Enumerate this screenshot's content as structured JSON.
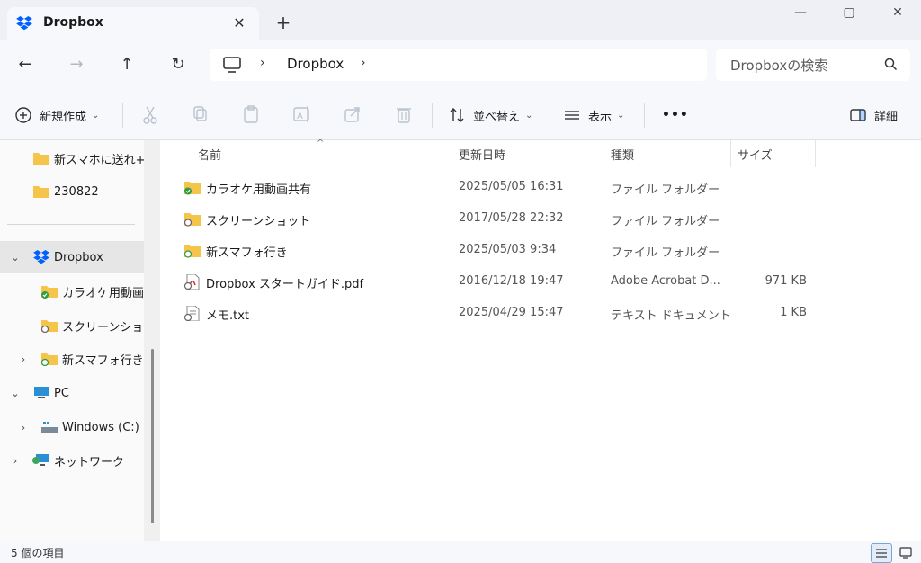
{
  "window": {
    "tab_title": "Dropbox",
    "tab_close_glyph": "✕",
    "new_tab_glyph": "+",
    "controls": {
      "minimize": "—",
      "maximize": "▢",
      "close": "✕"
    }
  },
  "nav": {
    "back": "←",
    "forward": "→",
    "up": "↑",
    "refresh": "↻",
    "breadcrumb": [
      "Dropbox"
    ],
    "separator": "›",
    "search_placeholder": "Dropboxの検索"
  },
  "commands": {
    "new": "新規作成",
    "sort": "並べ替え",
    "view": "表示",
    "more": "•••",
    "details": "詳細"
  },
  "sidebar": {
    "items": [
      {
        "label": "新スマホに送れ+R"
      },
      {
        "label": "230822"
      },
      {
        "label": "Dropbox"
      },
      {
        "label": "カラオケ用動画共"
      },
      {
        "label": "スクリーンショット"
      },
      {
        "label": "新スマフォ行き"
      },
      {
        "label": "PC"
      },
      {
        "label": "Windows (C:)"
      },
      {
        "label": "ネットワーク"
      }
    ]
  },
  "columns": {
    "name": "名前",
    "date": "更新日時",
    "type": "種類",
    "size": "サイズ"
  },
  "files": [
    {
      "name": "カラオケ用動画共有",
      "date": "2025/05/05 16:31",
      "type": "ファイル フォルダー",
      "size": "",
      "icon": "shared-folder-icon"
    },
    {
      "name": "スクリーンショット",
      "date": "2017/05/28 22:32",
      "type": "ファイル フォルダー",
      "size": "",
      "icon": "folder-icon"
    },
    {
      "name": "新スマフォ行き",
      "date": "2025/05/03 9:34",
      "type": "ファイル フォルダー",
      "size": "",
      "icon": "shared-folder-icon"
    },
    {
      "name": "Dropbox スタートガイド.pdf",
      "date": "2016/12/18 19:47",
      "type": "Adobe Acrobat D...",
      "size": "971 KB",
      "icon": "pdf-icon"
    },
    {
      "name": "メモ.txt",
      "date": "2025/04/29 15:47",
      "type": "テキスト ドキュメント",
      "size": "1 KB",
      "icon": "text-file-icon"
    }
  ],
  "status": {
    "item_count": "5 個の項目"
  },
  "colors": {
    "accent": "#0061fe",
    "folder": "#f4c44b",
    "sync_green": "#2e9d3f"
  }
}
